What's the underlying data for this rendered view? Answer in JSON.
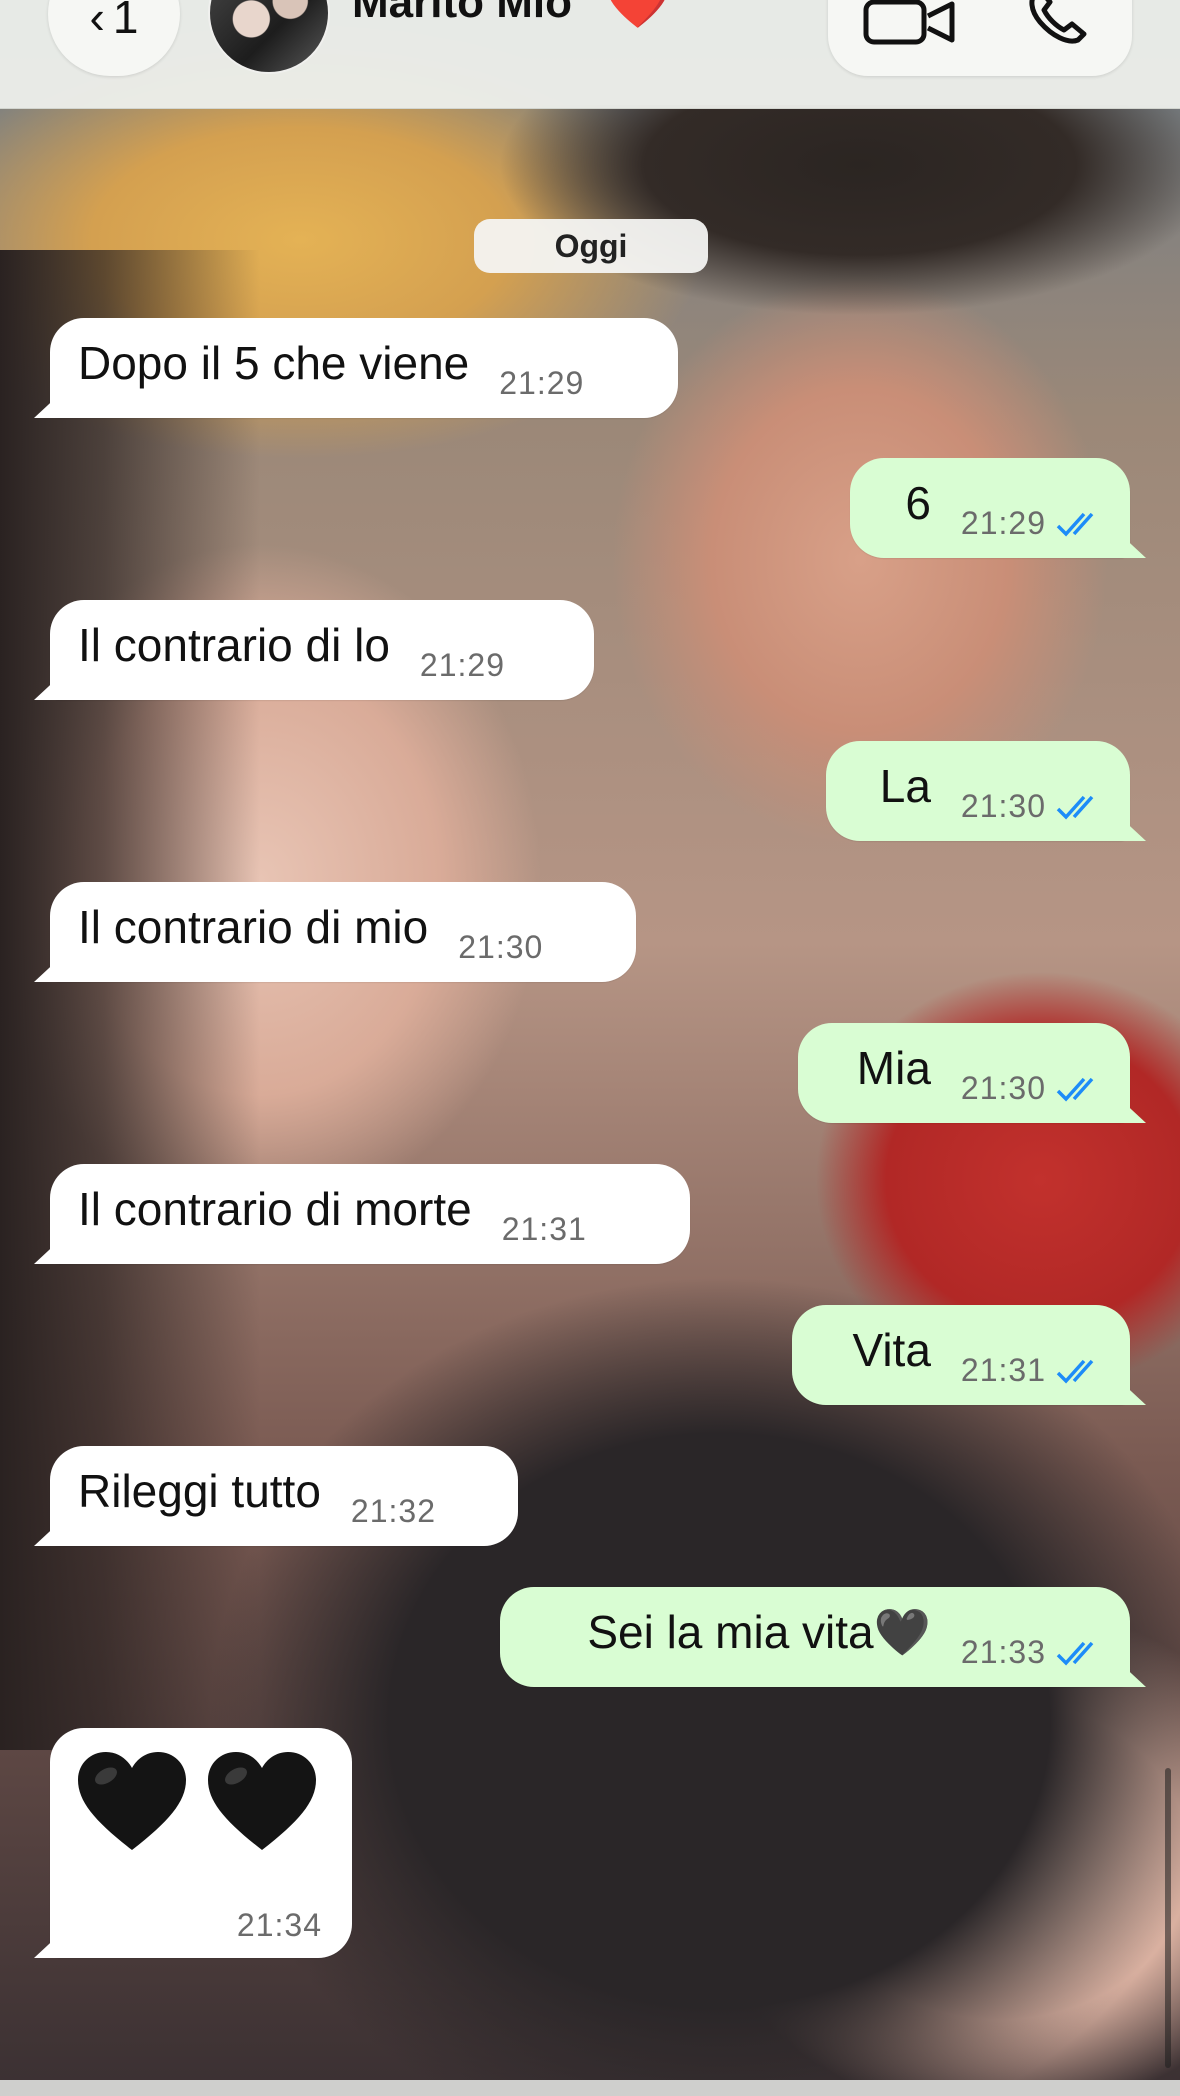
{
  "header": {
    "back_count": "1",
    "contact_name": "Marito Mio",
    "contact_emoji": "❤️",
    "video_icon": "video-camera-icon",
    "call_icon": "phone-icon"
  },
  "date_chip": "Oggi",
  "colors": {
    "incoming_bubble": "#ffffff",
    "outgoing_bubble": "#d9fdd3",
    "read_ticks": "#1d8cf8",
    "time_text": "#6b6b6b"
  },
  "messages": [
    {
      "direction": "incoming",
      "text": "Dopo il 5 che viene",
      "time": "21:29"
    },
    {
      "direction": "outgoing",
      "text": "6",
      "time": "21:29",
      "status": "read"
    },
    {
      "direction": "incoming",
      "text": "Il contrario di lo",
      "time": "21:29"
    },
    {
      "direction": "outgoing",
      "text": "La",
      "time": "21:30",
      "status": "read"
    },
    {
      "direction": "incoming",
      "text": "Il contrario di mio",
      "time": "21:30"
    },
    {
      "direction": "outgoing",
      "text": "Mia",
      "time": "21:30",
      "status": "read"
    },
    {
      "direction": "incoming",
      "text": "Il contrario di morte",
      "time": "21:31"
    },
    {
      "direction": "outgoing",
      "text": "Vita",
      "time": "21:31",
      "status": "read"
    },
    {
      "direction": "incoming",
      "text": "Rileggi tutto",
      "time": "21:32"
    },
    {
      "direction": "outgoing",
      "text": "Sei la mia vita🖤",
      "time": "21:33",
      "status": "read"
    },
    {
      "direction": "incoming",
      "text": "🖤🖤",
      "time": "21:34",
      "emoji_only": true
    }
  ]
}
